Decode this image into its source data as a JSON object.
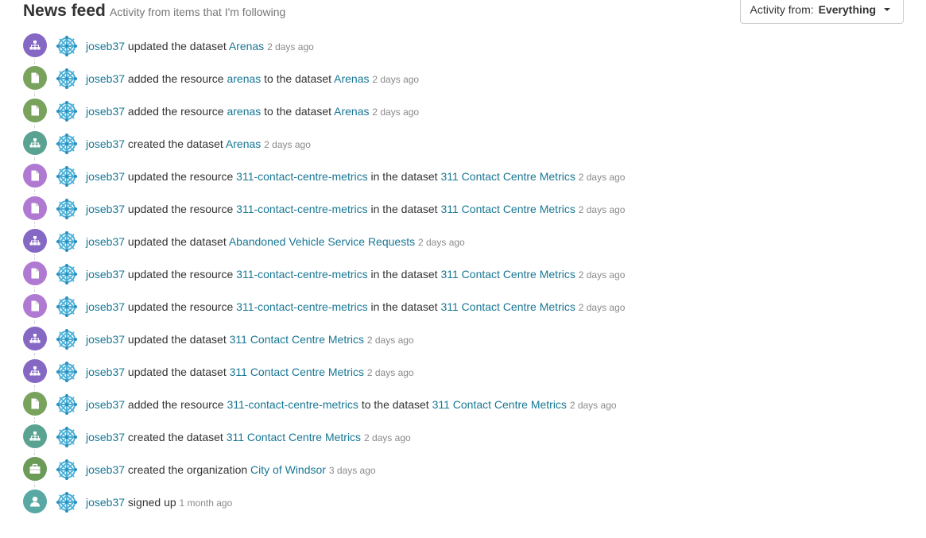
{
  "header": {
    "title": "News feed",
    "subtitle": "Activity from items that I'm following",
    "filter_label": "Activity from:",
    "filter_value": "Everything"
  },
  "colors": {
    "link": "#187794",
    "dataset_updated": "#8567c4",
    "resource_added": "#79a35d",
    "dataset_created": "#5aa392",
    "resource_updated": "#b07ad2",
    "organization_created": "#6c9a57",
    "user_signed_up": "#58a8a4"
  },
  "activities": [
    {
      "icon": "sitemap-icon",
      "color": "c-purple",
      "user": "joseb37",
      "verb": " updated the dataset ",
      "obj1": "Arenas",
      "mid": "",
      "obj2": "",
      "date": "2 days ago"
    },
    {
      "icon": "file-icon",
      "color": "c-green",
      "user": "joseb37",
      "verb": " added the resource ",
      "obj1": "arenas",
      "mid": " to the dataset ",
      "obj2": "Arenas",
      "date": "2 days ago"
    },
    {
      "icon": "file-icon",
      "color": "c-green",
      "user": "joseb37",
      "verb": " added the resource ",
      "obj1": "arenas",
      "mid": " to the dataset ",
      "obj2": "Arenas",
      "date": "2 days ago"
    },
    {
      "icon": "sitemap-icon",
      "color": "c-teal",
      "user": "joseb37",
      "verb": " created the dataset ",
      "obj1": "Arenas",
      "mid": "",
      "obj2": "",
      "date": "2 days ago"
    },
    {
      "icon": "file-icon",
      "color": "c-violet",
      "user": "joseb37",
      "verb": " updated the resource ",
      "obj1": "311-contact-centre-metrics",
      "mid": " in the dataset ",
      "obj2": "311 Contact Centre Metrics",
      "date": "2 days ago"
    },
    {
      "icon": "file-icon",
      "color": "c-violet",
      "user": "joseb37",
      "verb": " updated the resource ",
      "obj1": "311-contact-centre-metrics",
      "mid": " in the dataset ",
      "obj2": "311 Contact Centre Metrics",
      "date": "2 days ago"
    },
    {
      "icon": "sitemap-icon",
      "color": "c-purple",
      "user": "joseb37",
      "verb": " updated the dataset ",
      "obj1": "Abandoned Vehicle Service Requests",
      "mid": "",
      "obj2": "",
      "date": "2 days ago"
    },
    {
      "icon": "file-icon",
      "color": "c-violet",
      "user": "joseb37",
      "verb": " updated the resource ",
      "obj1": "311-contact-centre-metrics",
      "mid": " in the dataset ",
      "obj2": "311 Contact Centre Metrics",
      "date": "2 days ago"
    },
    {
      "icon": "file-icon",
      "color": "c-violet",
      "user": "joseb37",
      "verb": " updated the resource ",
      "obj1": "311-contact-centre-metrics",
      "mid": " in the dataset ",
      "obj2": "311 Contact Centre Metrics",
      "date": "2 days ago"
    },
    {
      "icon": "sitemap-icon",
      "color": "c-purple",
      "user": "joseb37",
      "verb": " updated the dataset ",
      "obj1": "311 Contact Centre Metrics",
      "mid": "",
      "obj2": "",
      "date": "2 days ago"
    },
    {
      "icon": "sitemap-icon",
      "color": "c-purple",
      "user": "joseb37",
      "verb": " updated the dataset ",
      "obj1": "311 Contact Centre Metrics",
      "mid": "",
      "obj2": "",
      "date": "2 days ago"
    },
    {
      "icon": "file-icon",
      "color": "c-green",
      "user": "joseb37",
      "verb": " added the resource ",
      "obj1": "311-contact-centre-metrics",
      "mid": " to the dataset ",
      "obj2": "311 Contact Centre Metrics",
      "date": "2 days ago"
    },
    {
      "icon": "sitemap-icon",
      "color": "c-teal",
      "user": "joseb37",
      "verb": " created the dataset ",
      "obj1": "311 Contact Centre Metrics",
      "mid": "",
      "obj2": "",
      "date": "2 days ago"
    },
    {
      "icon": "briefcase-icon",
      "color": "c-org",
      "user": "joseb37",
      "verb": " created the organization ",
      "obj1": "City of Windsor",
      "mid": "",
      "obj2": "",
      "date": "3 days ago"
    },
    {
      "icon": "user-icon",
      "color": "c-user",
      "user": "joseb37",
      "verb": " signed up",
      "obj1": "",
      "mid": "",
      "obj2": "",
      "date": "1 month ago"
    }
  ]
}
